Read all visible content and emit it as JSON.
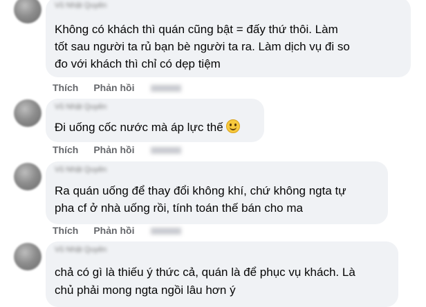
{
  "comments": [
    {
      "author": "Vũ Nhật Quyên",
      "lines": [
        "Không có khách thì quán cũng bật = đấy thứ thôi. Làm",
        "tốt sau người ta rủ bạn bè người ta ra. Làm dịch vụ đi so",
        "đo với khách thì chỉ có dẹp tiệm"
      ],
      "like_label": "Thích",
      "reply_label": "Phản hồi"
    },
    {
      "author": "Vũ Nhật Quyên",
      "lines": [
        "Đi uống cốc nước mà áp lực thế"
      ],
      "emoji": "slightly-smiling-face-icon",
      "like_label": "Thích",
      "reply_label": "Phản hồi"
    },
    {
      "author": "Vũ Nhật Quyên",
      "lines": [
        "Ra quán uống để thay đổi không khí, chứ không ngta tự",
        "pha cf ở nhà uống rồi, tính toán thế bán cho ma"
      ],
      "like_label": "Thích",
      "reply_label": "Phản hồi"
    },
    {
      "author": "Vũ Nhật Quyên",
      "lines": [
        "chả có gì là thiếu ý thức cả, quán là để phục vụ khách. Là",
        "chủ phải mong ngta ngồi lâu hơn ý"
      ]
    }
  ],
  "colors": {
    "bubble": "#f0f2f5",
    "action_text": "#65676b",
    "text": "#050505"
  }
}
